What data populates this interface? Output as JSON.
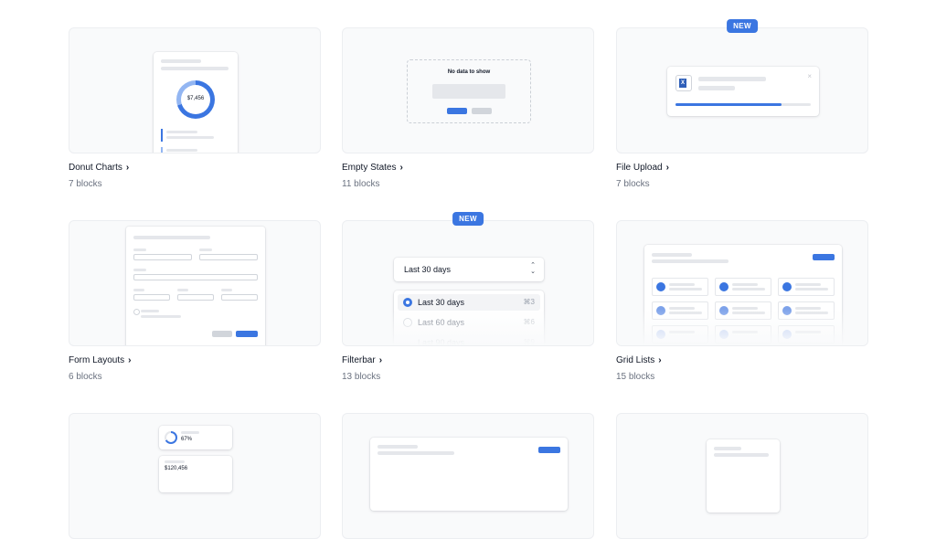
{
  "cards": [
    {
      "title": "Donut Charts",
      "count": "7 blocks"
    },
    {
      "title": "Empty States",
      "count": "11 blocks"
    },
    {
      "title": "File Upload",
      "count": "7 blocks",
      "badge": "NEW"
    },
    {
      "title": "Form Layouts",
      "count": "6 blocks"
    },
    {
      "title": "Filterbar",
      "count": "13 blocks",
      "badge": "NEW"
    },
    {
      "title": "Grid Lists",
      "count": "15 blocks"
    }
  ],
  "previews": {
    "donut_value": "$7,456",
    "empty_text": "No data to show",
    "file_icon": "X",
    "filter_selected": "Last 30 days",
    "filter_options": [
      {
        "label": "Last 30 days",
        "shortcut": "⌘3"
      },
      {
        "label": "Last 60 days",
        "shortcut": "⌘6"
      },
      {
        "label": "Last 90 days",
        "shortcut": "⌘9"
      }
    ],
    "kpi_percent": "67%",
    "kpi_value": "$120,456"
  },
  "icons": {
    "chevron": "›"
  },
  "colors": {
    "accent": "#3b76e1",
    "muted": "#6b7280"
  }
}
